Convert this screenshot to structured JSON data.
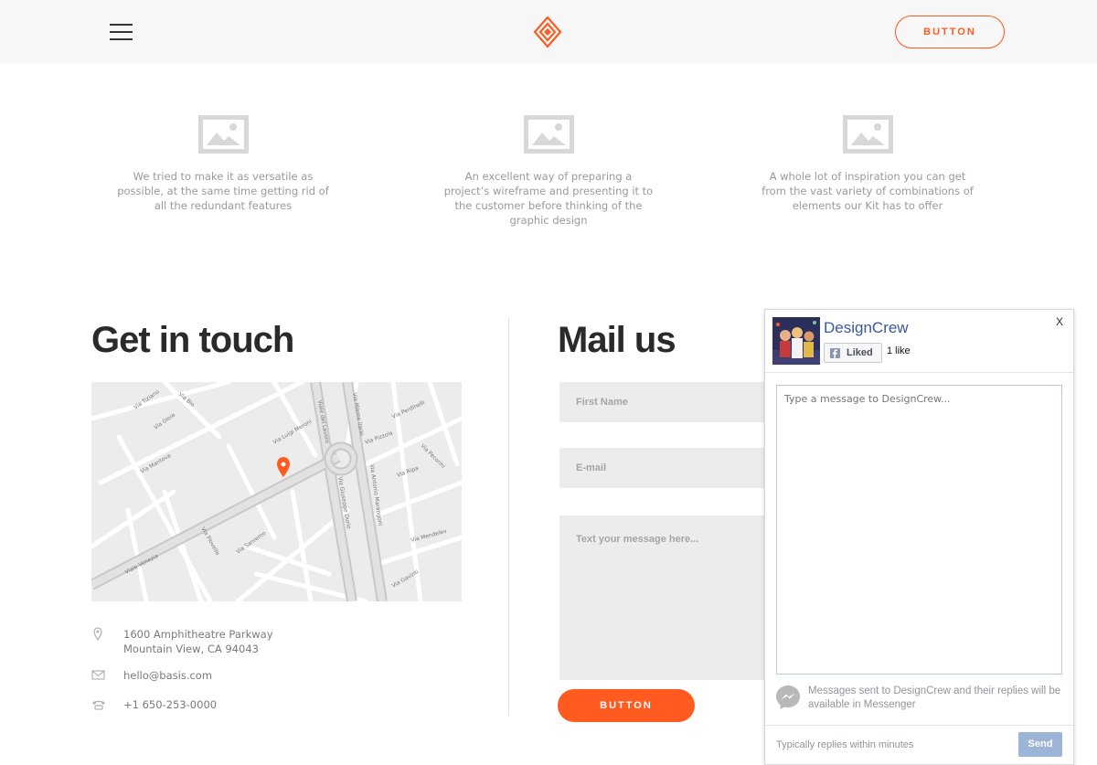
{
  "header": {
    "button_label": "BUTTON"
  },
  "features": [
    {
      "text": "We tried to make it as versatile as possible, at the same time getting rid of all the redundant features"
    },
    {
      "text": "An excellent way of preparing a project’s wireframe and presenting it to the customer before thinking of the graphic design"
    },
    {
      "text": "A whole lot of inspiration you can get from the vast variety of combinations of elements our Kit has to offer"
    }
  ],
  "contact": {
    "heading": "Get in touch",
    "address_line1": "1600 Amphitheatre Parkway",
    "address_line2": "Mountain View, CA 94043",
    "email": "hello@basis.com",
    "phone": "+1 650-253-0000"
  },
  "map": {
    "streets": [
      "Via Tiziano",
      "Via Gioia",
      "Via Bio",
      "Via Mantova",
      "Viale Venezia",
      "Via Luigi Meroni",
      "Viale del Lavoro",
      "Via Milone Ilario",
      "Via Pizzola",
      "Via Perdinelli",
      "Via Pecorini",
      "Via Ripa",
      "Via Giuseppe Durio",
      "Via Antonio Marangoni",
      "Via Mendelev",
      "Via Gavinti",
      "Via Sanremo",
      "Via Piovello"
    ]
  },
  "mail": {
    "heading": "Mail us",
    "first_name_placeholder": "First Name",
    "email_placeholder": "E-mail",
    "message_placeholder": "Text your message here...",
    "submit_label": "BUTTON"
  },
  "fb_widget": {
    "close_label": "X",
    "page_name": "DesignCrew",
    "liked_label": "Liked",
    "likes_count": "1 like",
    "message_placeholder": "Type a message to DesignCrew...",
    "messenger_note": "Messages sent to DesignCrew and their replies will be available in Messenger",
    "reply_time": "Typically replies within minutes",
    "send_label": "Send"
  },
  "colors": {
    "accent": "#ff5a1f",
    "header_bg": "#f7f7f7",
    "facebook_blue": "#3b5998"
  }
}
